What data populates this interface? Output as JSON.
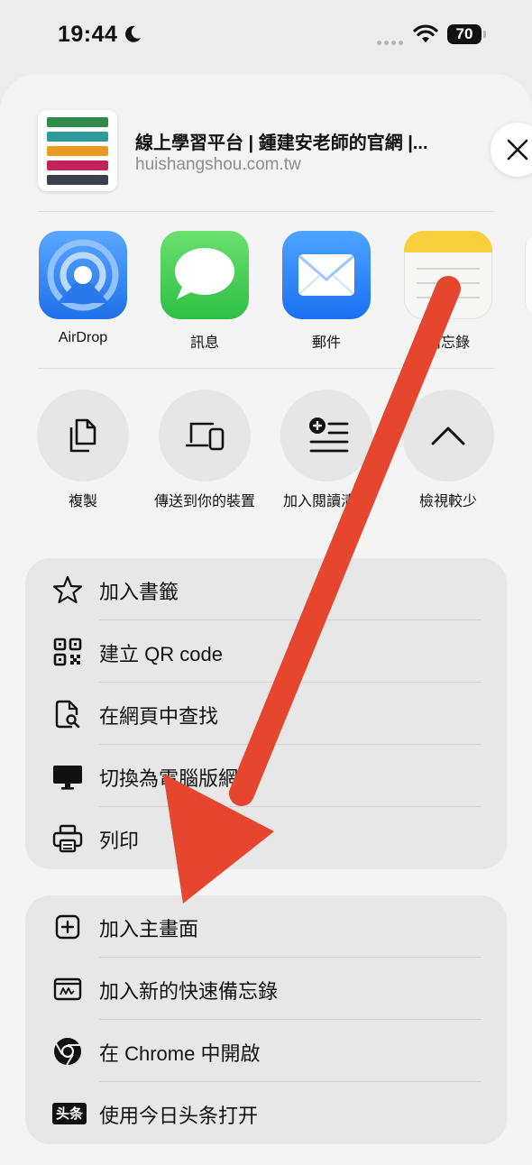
{
  "status_bar": {
    "time": "19:44",
    "battery": "70"
  },
  "share_sheet": {
    "site_title": "線上學習平台 | 鍾建安老師的官網 |...",
    "site_url": "huishangshou.com.tw",
    "apps": [
      {
        "label": "AirDrop",
        "icon": "airdrop-icon"
      },
      {
        "label": "訊息",
        "icon": "messages-icon"
      },
      {
        "label": "郵件",
        "icon": "mail-icon"
      },
      {
        "label": "備忘錄",
        "icon": "notes-icon"
      }
    ],
    "actions": [
      {
        "label": "複製",
        "icon": "copy-icon"
      },
      {
        "label": "傳送到你的裝置",
        "icon": "devices-icon"
      },
      {
        "label": "加入閱讀清單",
        "icon": "reading-list-icon"
      },
      {
        "label": "檢視較少",
        "icon": "chevron-up-icon"
      }
    ],
    "menu_group_1": [
      {
        "label": "加入書籤",
        "icon": "star-icon"
      },
      {
        "label": "建立 QR code",
        "icon": "qr-code-icon"
      },
      {
        "label": "在網頁中查找",
        "icon": "find-in-page-icon"
      },
      {
        "label": "切換為電腦版網站",
        "icon": "desktop-icon"
      },
      {
        "label": "列印",
        "icon": "printer-icon"
      }
    ],
    "menu_group_2": [
      {
        "label": "加入主畫面",
        "icon": "add-square-icon"
      },
      {
        "label": "加入新的快速備忘錄",
        "icon": "quick-note-icon"
      },
      {
        "label": "在 Chrome 中開啟",
        "icon": "chrome-icon"
      },
      {
        "label": "使用今日头条打开",
        "icon": "toutiao-icon"
      }
    ]
  },
  "toutiao_badge": "头条",
  "colors": {
    "arrow": "#e5462d",
    "accent_blue": "#2f7bf6",
    "messages_green": "#40c94f"
  }
}
